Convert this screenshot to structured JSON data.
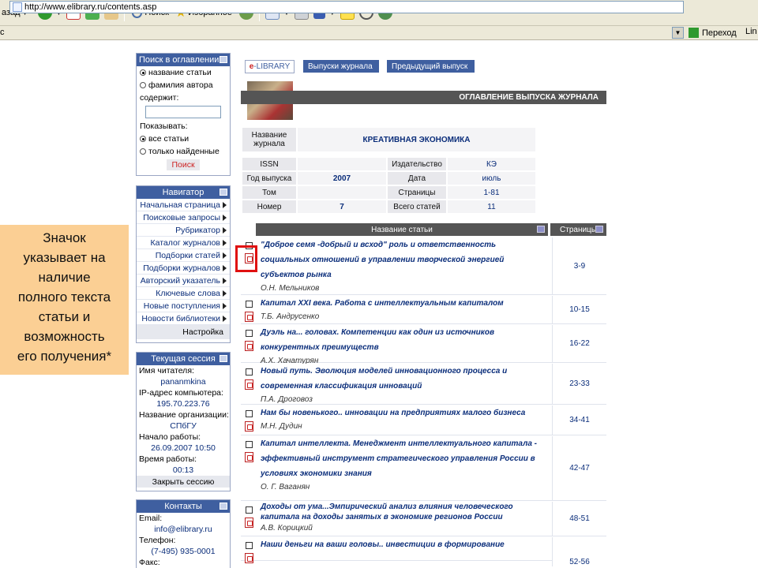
{
  "browser": {
    "back_label": "азад",
    "search_label": "Поиск",
    "favorites_label": "Избранное",
    "address": "http://www.elibrary.ru/contents.asp",
    "go_label": "Переход",
    "links_label": "Lin"
  },
  "search_panel": {
    "title": "Поиск в оглавлении",
    "opt_title": "название статьи",
    "opt_author": "фамилия автора",
    "contains_label": "содержит:",
    "show_label": "Показывать:",
    "show_all": "все статьи",
    "show_found": "только найденные",
    "search_button": "Поиск"
  },
  "navigator": {
    "title": "Навигатор",
    "items": [
      "Начальная страница",
      "Поисковые запросы",
      "Рубрикатор",
      "Каталог журналов",
      "Подборки статей",
      "Подборки журналов",
      "Авторский указатель",
      "Ключевые слова",
      "Новые поступления",
      "Новости библиотеки"
    ],
    "settings": "Настройка"
  },
  "session": {
    "title": "Текущая сессия",
    "reader_label": "Имя читателя:",
    "reader": "pananmkina",
    "ip_label": "IP-адрес компьютера:",
    "ip": "195.70.223.76",
    "org_label": "Название организации:",
    "org": "СПбГУ",
    "start_label": "Начало работы:",
    "start": "26.09.2007 10:50",
    "time_label": "Время работы:",
    "time": "00:13",
    "close": "Закрыть сессию"
  },
  "contacts": {
    "title": "Контакты",
    "email_label": "Email:",
    "email": "info@elibrary.ru",
    "phone_label": "Телефон:",
    "phone": "(7-495) 935-0001",
    "fax_label": "Факс:"
  },
  "callout_lines": [
    "Значок",
    "указывает на",
    "наличие",
    "полного текста",
    "статьи и",
    "возможность",
    "его получения*"
  ],
  "tabs": {
    "logo_e": "e",
    "logo_rest": "-LIBRARY",
    "issues": "Выпуски журнала",
    "prev": "Предыдущий выпуск"
  },
  "banner_title": "ОГЛАВЛЕНИЕ ВЫПУСКА ЖУРНАЛА",
  "journal": {
    "name_label": "Название журнала",
    "name": "КРЕАТИВНАЯ ЭКОНОМИКА",
    "issn_label": "ISSN",
    "issn": "",
    "publisher_label": "Издательство",
    "publisher": "КЭ",
    "year_label": "Год выпуска",
    "year": "2007",
    "date_label": "Дата",
    "date": "июль",
    "volume_label": "Том",
    "volume": "",
    "pages_label": "Страницы",
    "pages": "1-81",
    "number_label": "Номер",
    "number": "7",
    "total_label": "Всего статей",
    "total": "11"
  },
  "articles_header": {
    "title_col": "Название статьи",
    "pages_col": "Страницы"
  },
  "articles": [
    {
      "lines": [
        "\"Доброе семя -добрый и всход\" роль и ответственность",
        "социальных отношений в управлении творческой энергией",
        "субъектов рынка"
      ],
      "author": "О.Н. Мельников",
      "pages": "3-9"
    },
    {
      "lines": [
        "Капитал XXI века. Работа с интеллектуальным капиталом"
      ],
      "author": "Т.Б. Андрусенко",
      "pages": "10-15"
    },
    {
      "lines": [
        "Дуэль на... головах. Компетенции как один из источников",
        "конкурентных преимуществ"
      ],
      "author": "А.Х. Хачатурян",
      "pages": "16-22"
    },
    {
      "lines": [
        "Новый путь. Эволюция моделей инновационного процесса и",
        "современная классификация инноваций"
      ],
      "author": "П.А. Дроговоз",
      "pages": "23-33"
    },
    {
      "lines": [
        "Нам бы новенького.. инновации на предприятиях малого бизнеса"
      ],
      "author": "М.Н. Дудин",
      "pages": "34-41"
    },
    {
      "lines": [
        "Капитал интеллекта. Менеджмент интеллектуального капитала -",
        "эффективный инструмент стратегического управления России в",
        "условиях экономики знания"
      ],
      "author": "О. Г. Ваганян",
      "pages": "42-47"
    },
    {
      "lines": [
        "Доходы от ума...Эмпирический анализ влияния человеческого",
        "капитала на доходы занятых в экономике регионов России"
      ],
      "author": "А.В. Корицкий",
      "pages": "48-51"
    },
    {
      "lines": [
        "Наши деньги на ваши головы.. инвестиции в формирование"
      ],
      "author": "",
      "pages": "52-56"
    }
  ]
}
